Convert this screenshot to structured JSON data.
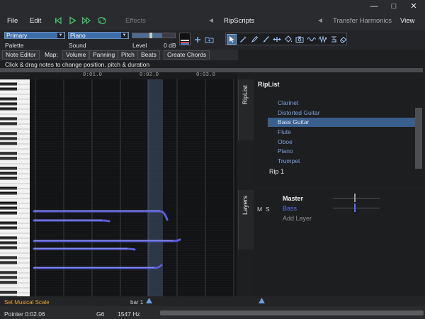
{
  "menu": {
    "file": "File",
    "edit": "Edit",
    "effects": "Effects",
    "ripscripts": "RipScripts",
    "transfer_harmonics": "Transfer Harmonics",
    "view": "View"
  },
  "window_controls": {
    "minimize": "—",
    "maximize": "□",
    "close": "✕"
  },
  "transport": {
    "rewind_icon": "rewind-icon",
    "play_icon": "play-icon",
    "forward_icon": "fast-forward-icon",
    "loop_icon": "loop-icon"
  },
  "toolbar": {
    "palette_value": "Primary",
    "palette_label": "Palette",
    "sound_value": "Piano",
    "sound_label": "Sound",
    "level_label": "Level",
    "level_value": "0 dB",
    "level_fraction": 0.7
  },
  "tabs": {
    "note_editor": "Note Editor",
    "map": "Map:",
    "volume": "Volume",
    "panning": "Panning",
    "pitch": "Pitch",
    "beats": "Beats",
    "create_chords": "Create Chords"
  },
  "hint": "Click & drag notes to change position, pitch & duration",
  "timeline": {
    "ticks": [
      "0:01.0",
      "0:02.0",
      "0:03.0"
    ]
  },
  "panels": {
    "riplist_tab": "RipList",
    "layers_tab": "Layers"
  },
  "riplist": {
    "title": "RipList",
    "items": [
      "Clarinet",
      "Distorted Guitar",
      "Bass Guitar",
      "Flute",
      "Oboe",
      "Piano",
      "Trumpet"
    ],
    "selected": "Bass Guitar",
    "rip_name": "Rip 1"
  },
  "layers": {
    "m": "M",
    "s": "S",
    "master": "Master",
    "bass": "Bass",
    "add_layer": "Add Layer"
  },
  "bottom": {
    "set_scale": "Set Musical Scale",
    "bar": "bar 1"
  },
  "status": {
    "pointer": "Pointer 0:02.06",
    "note": "G6",
    "freq": "1547 Hz"
  },
  "colors": {
    "accent": "#3d6ea8",
    "note": "#5a5fd6",
    "bass_text": "#5b6df0",
    "scale_text": "#e0a43a"
  }
}
